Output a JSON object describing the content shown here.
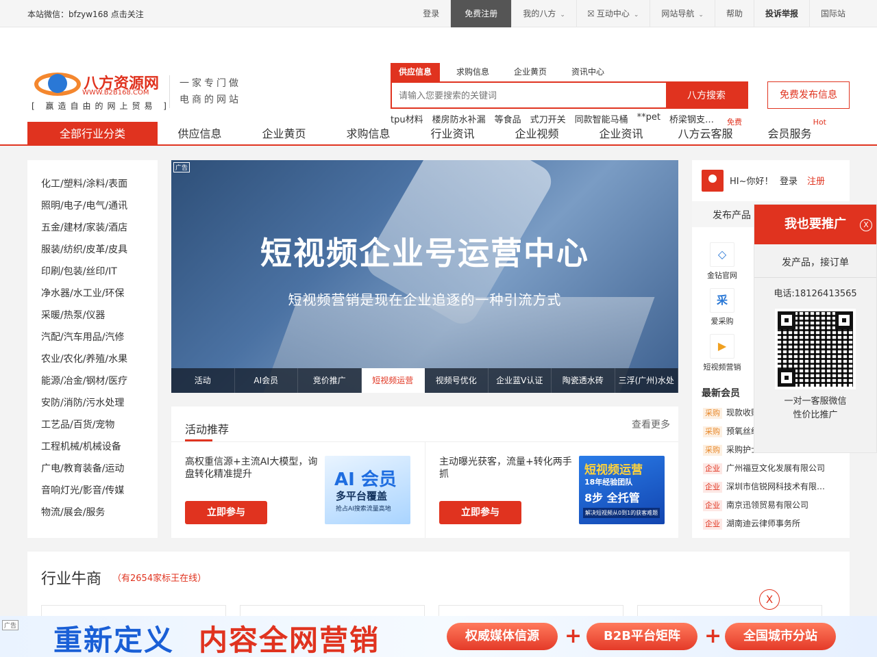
{
  "topbar": {
    "wechat": "本站微信：bfzyw168 点击关注",
    "links": {
      "login": "登录",
      "register": "免费注册",
      "my": "我的八方",
      "interact": "互动中心",
      "sitenav": "网站导航",
      "help": "帮助",
      "report": "投诉举报",
      "intl": "国际站"
    }
  },
  "logo": {
    "name": "八方资源网",
    "url": "WWW.B2B168.COM",
    "slogan": "[ 赢造自由的网上贸易 ]"
  },
  "tagline": {
    "line1": "一家专门做",
    "line2": "电商的网站"
  },
  "search": {
    "tabs": [
      "供应信息",
      "求购信息",
      "企业黄页",
      "资讯中心"
    ],
    "placeholder": "请输入您要搜索的关键词",
    "button": "八方搜索",
    "hotwords": [
      "tpu材料",
      "楼房防水补漏",
      "等食品",
      "式刀开关",
      "同款智能马桶",
      "**pet",
      "桥梁钢支…"
    ]
  },
  "free_publish": "免费发布信息",
  "nav": {
    "all": "全部行业分类",
    "items": [
      "供应信息",
      "企业黄页",
      "求购信息",
      "行业资讯",
      "企业视频",
      "企业资讯",
      "八方云客服",
      "会员服务"
    ],
    "badge_free": "免费",
    "badge_hot": "Hot"
  },
  "categories": [
    "化工/塑料/涂料/表面",
    "照明/电子/电气/通讯",
    "五金/建材/家装/酒店",
    "服装/纺织/皮革/皮具",
    "印刷/包装/丝印/IT",
    "净水器/水工业/环保",
    "采暖/热泵/仪器",
    "汽配/汽车用品/汽修",
    "农业/农化/养殖/水果",
    "能源/冶金/钢材/医疗",
    "安防/消防/污水处理",
    "工艺品/百货/宠物",
    "工程机械/机械设备",
    "广电/教育装备/运动",
    "音响灯光/影音/传媒",
    "物流/展会/服务"
  ],
  "banner": {
    "ad": "广告",
    "title": "短视频企业号运营中心",
    "subtitle": "短视频营销是现在企业追逐的一种引流方式",
    "tabs": [
      "活动",
      "AI会员",
      "竞价推广",
      "短视频运营",
      "视频号优化",
      "企业蓝V认证",
      "陶瓷透水砖",
      "三浮(广州)水处"
    ]
  },
  "activity": {
    "title": "活动推荐",
    "more": "查看更多",
    "cards": [
      {
        "text": "高权重信源+主流AI大模型，询盘转化精准提升",
        "button": "立即参与",
        "img": {
          "l1": "AI 会员",
          "l2": "多平台覆盖",
          "l3": "抢占AI搜索流量高地"
        }
      },
      {
        "text": "主动曝光获客，流量+转化两手抓",
        "button": "立即参与",
        "img": {
          "l1": "短视频运营",
          "l2": "18年经验团队",
          "l3": "8步 全托管",
          "l4": "解决短视频从0到1的获客难题"
        }
      }
    ]
  },
  "user": {
    "hi": "HI~你好！",
    "login": "登录",
    "register": "注册",
    "publish": "发布产品",
    "services": [
      "金钻官网",
      "爱采购",
      "短视频营销"
    ],
    "service_icons": [
      "diamond-icon",
      "cai-icon",
      "play-icon"
    ],
    "service_glyphs": [
      "◇",
      "采",
      "▶"
    ],
    "newest": "最新会员",
    "members": [
      {
        "tag": "采购",
        "name": "现款收购…"
      },
      {
        "tag": "采购",
        "name": "预氧丝纱…"
      },
      {
        "tag": "采购",
        "name": "采购护士…"
      },
      {
        "tag": "企业",
        "name": "广州福豆文化发展有限公司"
      },
      {
        "tag": "企业",
        "name": "深圳市信锐网科技术有限…"
      },
      {
        "tag": "企业",
        "name": "南京迅领贸易有限公司"
      },
      {
        "tag": "企业",
        "name": "湖南迪云律师事务所"
      }
    ]
  },
  "promo": {
    "title": "我也要推广",
    "close": "X",
    "line1": "发产品，接订单",
    "phone": "电话:18126413565",
    "cap1": "一对一客服微信",
    "cap2": "性价比推广"
  },
  "industry": {
    "title": "行业牛商",
    "sub": "（有2654家标王在线）",
    "close": "X"
  },
  "bottom_ad": {
    "ad": "广告",
    "big1": "重新定义",
    "big2": "内容全网营销",
    "pills": [
      "权威媒体信源",
      "B2B平台矩阵",
      "全国城市分站"
    ],
    "plus": "+"
  },
  "colors": {
    "accent": "#e0331f",
    "blue": "#1a5fd6"
  }
}
